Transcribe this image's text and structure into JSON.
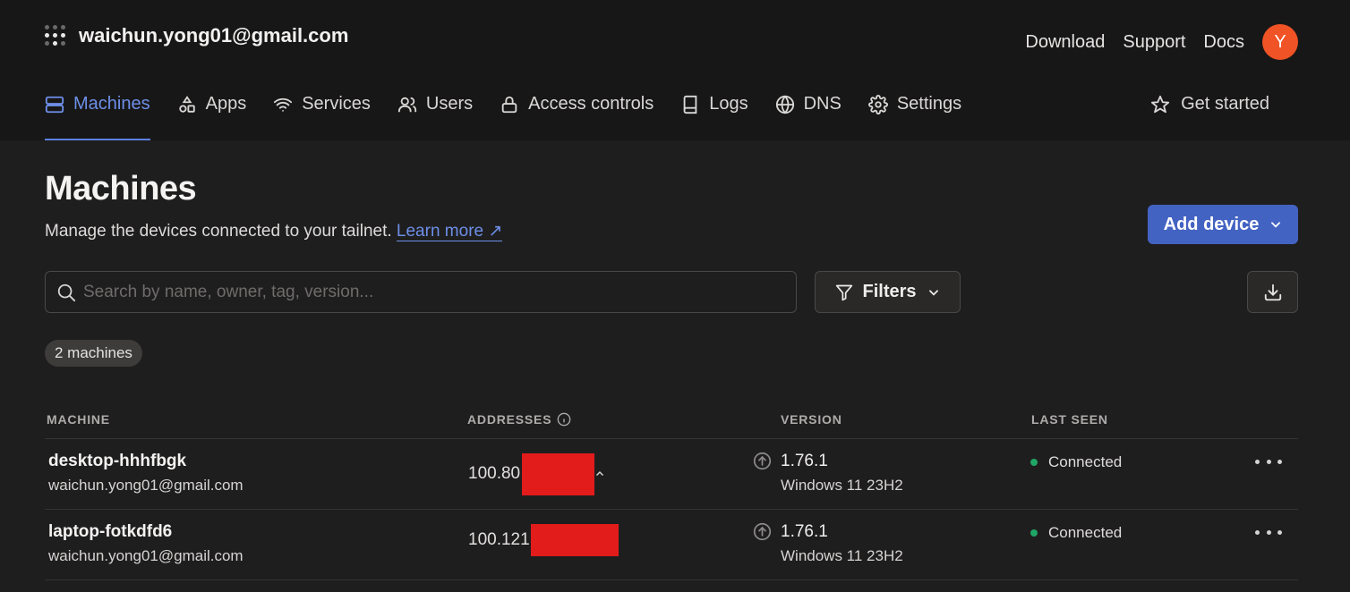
{
  "header": {
    "account_email": "waichun.yong01@gmail.com",
    "links": [
      "Download",
      "Support",
      "Docs"
    ],
    "avatar_initial": "Y",
    "avatar_color": "#f05325"
  },
  "nav": {
    "items": [
      {
        "label": "Machines",
        "icon": "machines-icon",
        "active": true
      },
      {
        "label": "Apps",
        "icon": "apps-icon"
      },
      {
        "label": "Services",
        "icon": "wifi-icon"
      },
      {
        "label": "Users",
        "icon": "users-icon"
      },
      {
        "label": "Access controls",
        "icon": "lock-icon"
      },
      {
        "label": "Logs",
        "icon": "book-icon"
      },
      {
        "label": "DNS",
        "icon": "globe-icon"
      },
      {
        "label": "Settings",
        "icon": "gear-icon"
      }
    ],
    "get_started": "Get started"
  },
  "page": {
    "title": "Machines",
    "description": "Manage the devices connected to your tailnet.",
    "learn_more": "Learn more ↗",
    "add_device": "Add device",
    "search_placeholder": "Search by name, owner, tag, version...",
    "filters_label": "Filters",
    "machine_count": "2 machines"
  },
  "table": {
    "headers": [
      "MACHINE",
      "ADDRESSES",
      "VERSION",
      "LAST SEEN"
    ],
    "rows": [
      {
        "name": "desktop-hhhfbgk",
        "owner": "waichun.yong01@gmail.com",
        "address": "100.80",
        "version": "1.76.1",
        "os": "Windows 11 23H2",
        "status": "Connected"
      },
      {
        "name": "laptop-fotkdfd6",
        "owner": "waichun.yong01@gmail.com",
        "address": "100.121",
        "version": "1.76.1",
        "os": "Windows 11 23H2",
        "status": "Connected"
      }
    ]
  },
  "colors": {
    "accent": "#6d8fe8",
    "primary_button": "#4363c3",
    "status_connected": "#1fa565",
    "redaction": "#e21b1b"
  }
}
